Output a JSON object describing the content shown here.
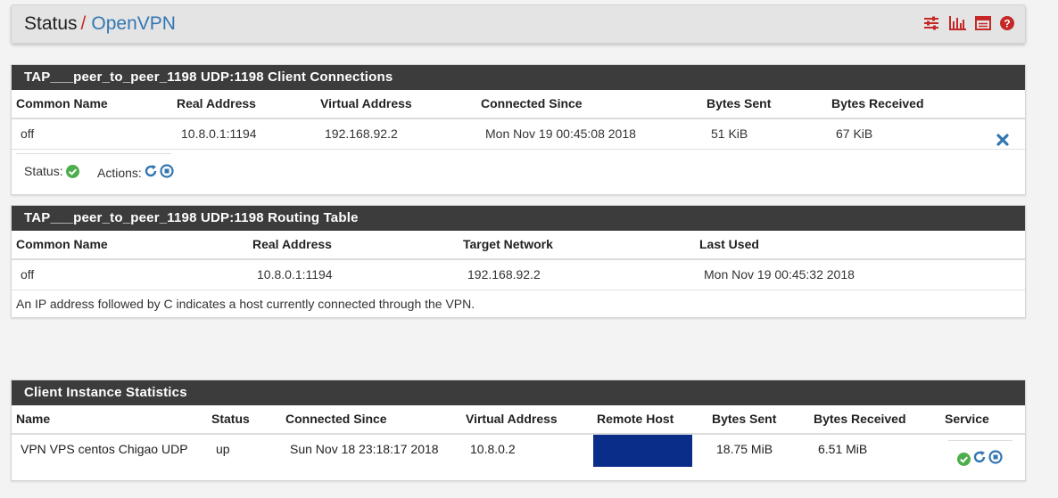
{
  "breadcrumb": {
    "status": "Status",
    "separator": "/",
    "current": "OpenVPN"
  },
  "header_icons": [
    "sliders-icon",
    "bar-chart-icon",
    "log-icon",
    "help-icon"
  ],
  "colors": {
    "accent_red": "#c62828",
    "link_blue": "#3277b2",
    "panel_header": "#3c3c3c",
    "ok_green": "#4cae4c",
    "redaction": "#0a2d8a"
  },
  "client_connections": {
    "title": "TAP___peer_to_peer_1198 UDP:1198 Client Connections",
    "columns": [
      "Common Name",
      "Real Address",
      "Virtual Address",
      "Connected Since",
      "Bytes Sent",
      "Bytes Received"
    ],
    "rows": [
      {
        "common_name": "off",
        "real_address": "10.8.0.1:1194",
        "virtual_address": "192.168.92.2",
        "connected_since": "Mon Nov 19 00:45:08 2018",
        "bytes_sent": "51 KiB",
        "bytes_received": "67 KiB"
      }
    ],
    "status_label": "Status:",
    "actions_label": "Actions:"
  },
  "routing_table": {
    "title": "TAP___peer_to_peer_1198 UDP:1198 Routing Table",
    "columns": [
      "Common Name",
      "Real Address",
      "Target Network",
      "Last Used"
    ],
    "rows": [
      {
        "common_name": "off",
        "real_address": "10.8.0.1:1194",
        "target_network": "192.168.92.2",
        "last_used": "Mon Nov 19 00:45:32 2018"
      }
    ],
    "note": "An IP address followed by C indicates a host currently connected through the VPN."
  },
  "client_stats": {
    "title": "Client Instance Statistics",
    "columns": [
      "Name",
      "Status",
      "Connected Since",
      "Virtual Address",
      "Remote Host",
      "Bytes Sent",
      "Bytes Received",
      "Service"
    ],
    "rows": [
      {
        "name": "VPN VPS centos Chigao UDP",
        "status": "up",
        "connected_since": "Sun Nov 18 23:18:17 2018",
        "virtual_address": "10.8.0.2",
        "remote_host": "",
        "bytes_sent": "18.75 MiB",
        "bytes_received": "6.51 MiB"
      }
    ]
  }
}
